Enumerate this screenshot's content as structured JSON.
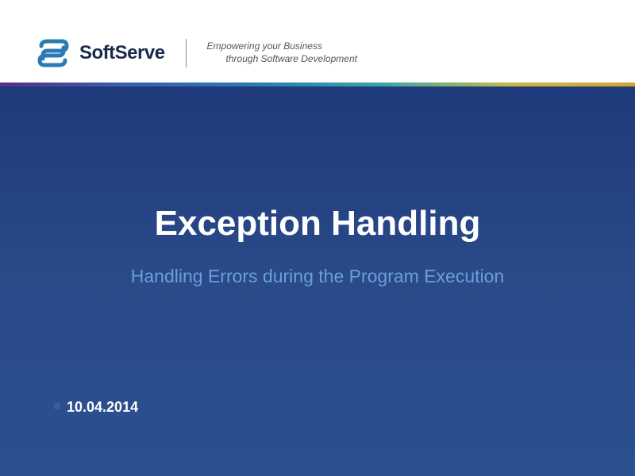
{
  "header": {
    "company_name": "SoftServe",
    "tagline_line1": "Empowering your Business",
    "tagline_line2": "through Software Development"
  },
  "main": {
    "title": "Exception Handling",
    "subtitle": "Handling Errors during the Program Execution",
    "date": "10.04.2014"
  }
}
